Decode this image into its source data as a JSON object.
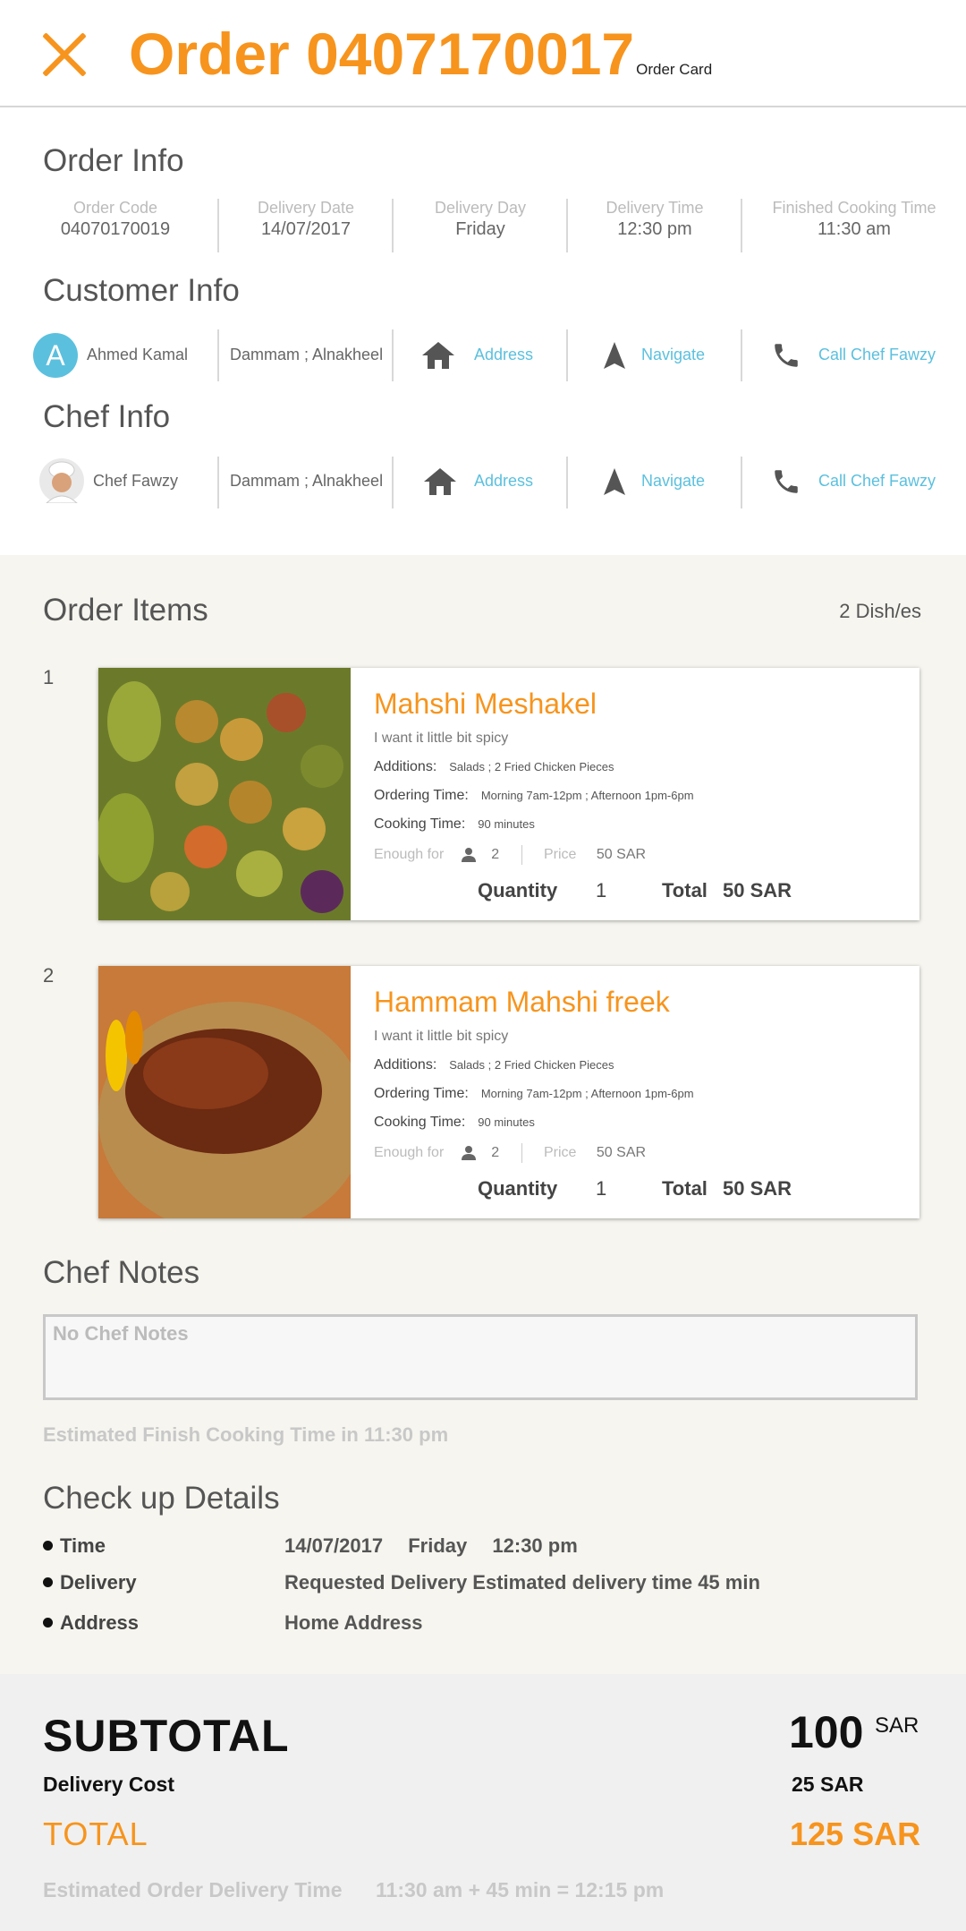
{
  "header": {
    "title": "Order 0407170017",
    "subtitle": "Order Card"
  },
  "order_info": {
    "heading": "Order Info",
    "fields": [
      {
        "label": "Order Code",
        "value": "04070170019"
      },
      {
        "label": "Delivery Date",
        "value": "14/07/2017"
      },
      {
        "label": "Delivery Day",
        "value": "Friday"
      },
      {
        "label": "Delivery Time",
        "value": "12:30 pm"
      },
      {
        "label": "Finished Cooking Time",
        "value": "11:30 am"
      }
    ]
  },
  "customer_info": {
    "heading": "Customer Info",
    "avatar_letter": "A",
    "avatar_color": "#5bc0de",
    "name": "Ahmed Kamal",
    "location": "Dammam ; Alnakheel",
    "address_label": "Address",
    "navigate_label": "Navigate",
    "call_label": "Call Chef Fawzy"
  },
  "chef_info": {
    "heading": "Chef Info",
    "name": "Chef Fawzy",
    "location": "Dammam ; Alnakheel",
    "address_label": "Address",
    "navigate_label": "Navigate",
    "call_label": "Call Chef Fawzy"
  },
  "order_items": {
    "heading": "Order Items",
    "count": "2 Dish/es",
    "items": [
      {
        "index": "1",
        "name": "Mahshi Meshakel",
        "note": "I want it little bit spicy",
        "additions_label": "Additions:",
        "additions": "Salads ; 2 Fried Chicken Pieces",
        "ordering_label": "Ordering Time:",
        "ordering": "Morning 7am-12pm ; Afternoon 1pm-6pm",
        "cooking_label": "Cooking Time:",
        "cooking": "90 minutes",
        "enough_label": "Enough for",
        "enough": "2",
        "price_label": "Price",
        "price": "50 SAR",
        "quantity_label": "Quantity",
        "quantity": "1",
        "total_label": "Total",
        "total": "50 SAR"
      },
      {
        "index": "2",
        "name": "Hammam Mahshi freek",
        "note": "I want it little bit spicy",
        "additions_label": "Additions:",
        "additions": "Salads ; 2 Fried Chicken Pieces",
        "ordering_label": "Ordering Time:",
        "ordering": "Morning 7am-12pm ; Afternoon 1pm-6pm",
        "cooking_label": "Cooking Time:",
        "cooking": "90 minutes",
        "enough_label": "Enough for",
        "enough": "2",
        "price_label": "Price",
        "price": "50 SAR",
        "quantity_label": "Quantity",
        "quantity": "1",
        "total_label": "Total",
        "total": "50 SAR"
      }
    ]
  },
  "chef_notes": {
    "heading": "Chef Notes",
    "placeholder": "No Chef Notes",
    "estimate": "Estimated Finish Cooking Time in 11:30 pm"
  },
  "checkup": {
    "heading": "Check up Details",
    "rows": [
      {
        "label": "Time",
        "date": "14/07/2017",
        "day": "Friday",
        "time": "12:30 pm"
      },
      {
        "label": "Delivery",
        "value": "Requested Delivery Estimated delivery time 45 min"
      },
      {
        "label": "Address",
        "value": "Home Address"
      }
    ]
  },
  "summary": {
    "subtotal_label": "SUBTOTAL",
    "subtotal_value": "100",
    "subtotal_currency": "SAR",
    "delivery_label": "Delivery Cost",
    "delivery_value": "25 SAR",
    "total_label": "TOTAL",
    "total_value": "125 SAR",
    "estimate_label": "Estimated Order Delivery Time",
    "estimate_value": "11:30 am + 45 min = 12:15 pm"
  },
  "colors": {
    "accent": "#f7941d",
    "link": "#5bc0de"
  }
}
